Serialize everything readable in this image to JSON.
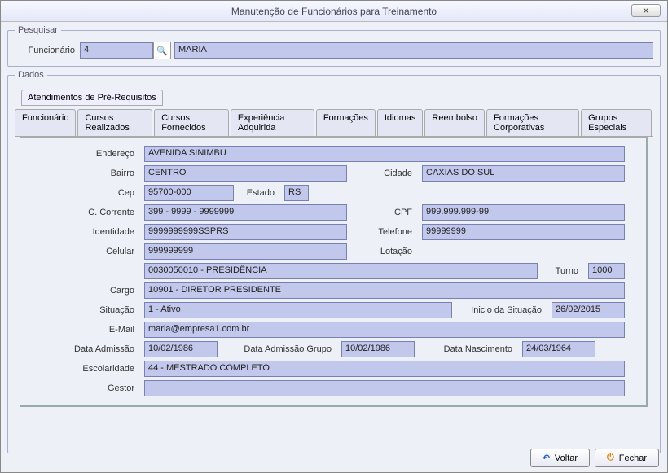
{
  "window": {
    "title": "Manutenção de Funcionários para Treinamento",
    "close_glyph": "✕"
  },
  "search": {
    "legend": "Pesquisar",
    "label": "Funcionário",
    "id": "4",
    "name": "MARIA",
    "lookup_glyph": "🔍"
  },
  "dados": {
    "legend": "Dados",
    "subtab": "Atendimentos de Pré-Requisitos",
    "tabs": [
      "Funcionário",
      "Cursos Realizados",
      "Cursos Fornecidos",
      "Experiência Adquirida",
      "Formações",
      "Idiomas",
      "Reembolso",
      "Formações Corporativas",
      "Grupos Especiais"
    ]
  },
  "form": {
    "endereco_lbl": "Endereço",
    "endereco": "AVENIDA SINIMBU",
    "bairro_lbl": "Bairro",
    "bairro": "CENTRO",
    "cidade_lbl": "Cidade",
    "cidade": "CAXIAS DO SUL",
    "cep_lbl": "Cep",
    "cep": "95700-000",
    "estado_lbl": "Estado",
    "estado": "RS",
    "ccorrente_lbl": "C. Corrente",
    "ccorrente": "399 - 9999 - 9999999",
    "cpf_lbl": "CPF",
    "cpf": "999.999.999-99",
    "identidade_lbl": "Identidade",
    "identidade": "9999999999SSPRS",
    "telefone_lbl": "Telefone",
    "telefone": "99999999",
    "celular_lbl": "Celular",
    "celular": "999999999",
    "lotacao_lbl": "Lotação",
    "lotacao": "0030050010 - PRESIDÊNCIA",
    "turno_lbl": "Turno",
    "turno": "1000",
    "cargo_lbl": "Cargo",
    "cargo": "10901 - DIRETOR PRESIDENTE",
    "situacao_lbl": "Situação",
    "situacao": "1 - Ativo",
    "inicio_lbl": "Inicio da Situação",
    "inicio": "26/02/2015",
    "email_lbl": "E-Mail",
    "email": "maria@empresa1.com.br",
    "admissao_lbl": "Data Admissão",
    "admissao": "10/02/1986",
    "admgrupo_lbl": "Data Admissão Grupo",
    "admgrupo": "10/02/1986",
    "nascimento_lbl": "Data Nascimento",
    "nascimento": "24/03/1964",
    "escolaridade_lbl": "Escolaridade",
    "escolaridade": "44 - MESTRADO COMPLETO",
    "gestor_lbl": "Gestor",
    "gestor": ""
  },
  "footer": {
    "voltar": "Voltar",
    "fechar": "Fechar",
    "voltar_glyph": "↶",
    "fechar_glyph": "⏻"
  }
}
